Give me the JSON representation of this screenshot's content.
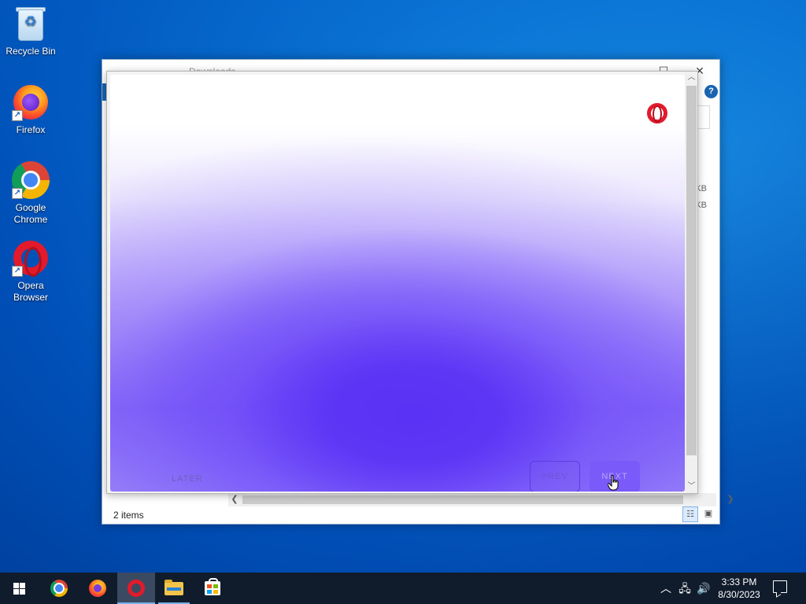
{
  "desktop": {
    "icons": [
      {
        "label": "Recycle Bin",
        "icon": "recycle-bin-icon"
      },
      {
        "label": "Firefox",
        "icon": "firefox-icon"
      },
      {
        "label": "Google Chrome",
        "icon": "chrome-icon"
      },
      {
        "label": "Opera Browser",
        "icon": "opera-icon"
      }
    ]
  },
  "explorer": {
    "title": "Downloads",
    "sizes": [
      "KB",
      "KB"
    ],
    "status": "2 items"
  },
  "dialog": {
    "later_label": "LATER",
    "prev_label": "PREV",
    "next_label": "NEXT",
    "brand_color": "#e3192c",
    "accent_color": "#5a32f5"
  },
  "taskbar": {
    "pinned": [
      "start-button",
      "chrome",
      "firefox",
      "opera",
      "file-explorer",
      "microsoft-store"
    ],
    "active": "opera",
    "time": "3:33 PM",
    "date": "8/30/2023"
  }
}
